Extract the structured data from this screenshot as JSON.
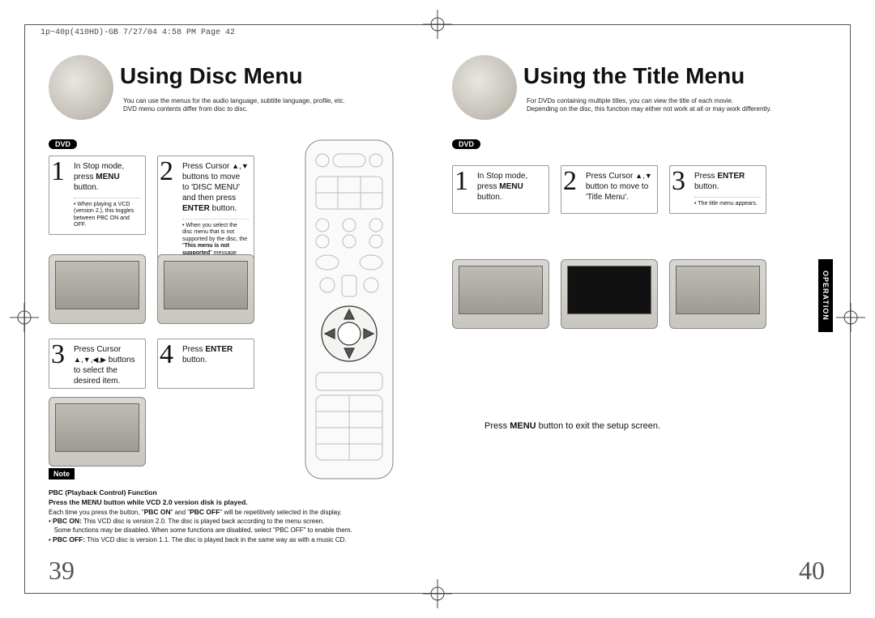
{
  "print_header": "1p~40p(410HD)-GB  7/27/04 4:58 PM  Page 42",
  "left": {
    "title": "Using Disc Menu",
    "subtitle": "You can use the menus for the audio language, subtitle language, profile, etc.\nDVD menu contents differ from disc to disc.",
    "badge": "DVD",
    "steps": {
      "s1": {
        "num": "1",
        "text": "In Stop mode, press <b>MENU</b> button.",
        "sub": "• When playing a VCD (version 2.), this toggles between PBC ON and OFF."
      },
      "s2": {
        "num": "2",
        "text": "Press Cursor <span class='arrow'>▲</span>,<span class='arrow'>▼</span> buttons to move to 'DISC MENU' and then press <b>ENTER</b> button.",
        "sub": "• When you select the disc menu that is not supported by the disc, the \"<b>This menu is not supported</b>\" message appears on the screen."
      },
      "s3": {
        "num": "3",
        "text": "Press Cursor <span class='arrow'>▲</span>,<span class='arrow'>▼</span>,<span class='arrow'>◀</span>,<span class='arrow'>▶</span> buttons to select the desired item."
      },
      "s4": {
        "num": "4",
        "text": "Press <b>ENTER</b> button."
      }
    },
    "note_label": "Note",
    "note_title": "PBC (Playback Control) Function",
    "note_body": "<b>Press the MENU button while VCD 2.0 version disk is played.</b><br>Each time you press the button, \"<b>PBC ON</b>\" and \"<b>PBC OFF</b>\" will be repetitively selected in the display.<br>• <b>PBC ON:</b> This VCD disc is version 2.0. The disc is played back according to the menu screen.<br>&nbsp;&nbsp;&nbsp;Some functions may be disabled. When some functions are disabled, select \"PBC OFF\" to enable them.<br>• <b>PBC OFF:</b> This VCD disc is version 1.1. The disc is played back in the same way as with a music CD.",
    "page_num": "39"
  },
  "right": {
    "title": "Using the Title Menu",
    "subtitle": "For DVDs containing multiple titles, you can view the title of each movie.\nDepending on the disc, this function may either not work at all or may work differently.",
    "badge": "DVD",
    "steps": {
      "s1": {
        "num": "1",
        "text": "In Stop mode, press <b>MENU</b> button."
      },
      "s2": {
        "num": "2",
        "text": "Press Cursor <span class='arrow'>▲</span>,<span class='arrow'>▼</span> button to move to 'Title Menu'."
      },
      "s3": {
        "num": "3",
        "text": "Press <b>ENTER</b> button.",
        "sub": "• The title menu appears."
      }
    },
    "footer_hint": "Press <b>MENU</b> button to exit the setup screen.",
    "side_tab": "OPERATION",
    "page_num": "40"
  }
}
